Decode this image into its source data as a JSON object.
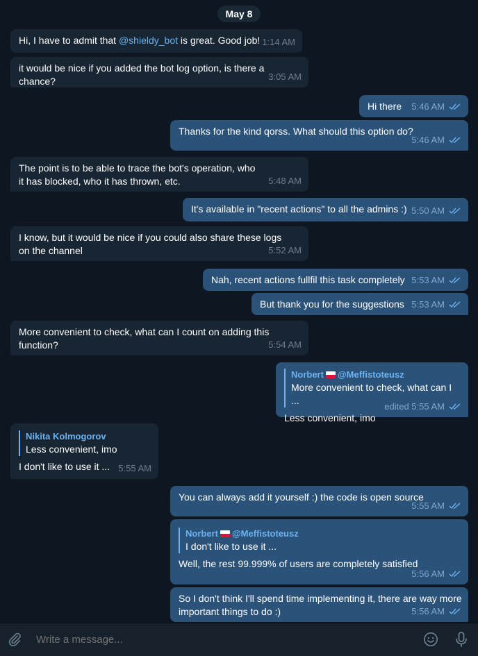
{
  "date": "May 8",
  "messages": {
    "m1": {
      "pre": "Hi, I have to admit that ",
      "mention": "@shieldy_bot",
      "post": " is great. Good job!",
      "time": "1:14 AM"
    },
    "m2": {
      "text": "it would be nice if you added the bot log option, is there a chance?",
      "time": "3:05 AM"
    },
    "m3": {
      "text": "Hi there",
      "time": "5:46 AM"
    },
    "m4": {
      "text": "Thanks for the kind qorss. What should this option do?",
      "time": "5:46 AM"
    },
    "m5": {
      "text": "The point is to be able to trace the bot's operation, who it has blocked, who it has thrown, etc.",
      "time": "5:48 AM"
    },
    "m6": {
      "text": "It's available in \"recent actions\" to all the admins :)",
      "time": "5:50 AM"
    },
    "m7": {
      "text": "I know, but it would be nice if you could also share these logs on the channel",
      "time": "5:52 AM"
    },
    "m8": {
      "text": "Nah, recent actions fullfil this task completely",
      "time": "5:53 AM"
    },
    "m9": {
      "text": "But thank you for the suggestions",
      "time": "5:53 AM"
    },
    "m10": {
      "text": "More convenient to check, what can I count on adding this function?",
      "time": "5:54 AM"
    },
    "m11": {
      "reply_author": "Norbert",
      "reply_handle": "@Meffistoteusz",
      "reply_text": "More convenient to check, what can I ...",
      "text": "Less convenient, imo",
      "time": "edited 5:55 AM"
    },
    "m12": {
      "reply_author": "Nikita Kolmogorov",
      "reply_text": "Less convenient, imo",
      "text": "I don't like to use it ...",
      "time": "5:55 AM"
    },
    "m13": {
      "text": "You can always add it yourself :) the code is open source",
      "time": "5:55 AM"
    },
    "m14": {
      "reply_author": "Norbert",
      "reply_handle": "@Meffistoteusz",
      "reply_text": "I don't like to use it ...",
      "text": "Well, the rest 99.999% of users are completely satisfied",
      "time": "5:56 AM"
    },
    "m15": {
      "text": "So I don't think I'll spend time implementing it, there are way more important things to do :)",
      "time": "5:56 AM"
    }
  },
  "composer": {
    "placeholder": "Write a message..."
  },
  "colors": {
    "background": "#0e1621",
    "incoming": "#182533",
    "outgoing": "#2b5278",
    "accent": "#6ab3f3",
    "composer": "#17212b"
  },
  "icons": {
    "attach": "paperclip-icon",
    "emoji": "smile-icon",
    "mic": "microphone-icon",
    "read": "double-check-icon"
  }
}
